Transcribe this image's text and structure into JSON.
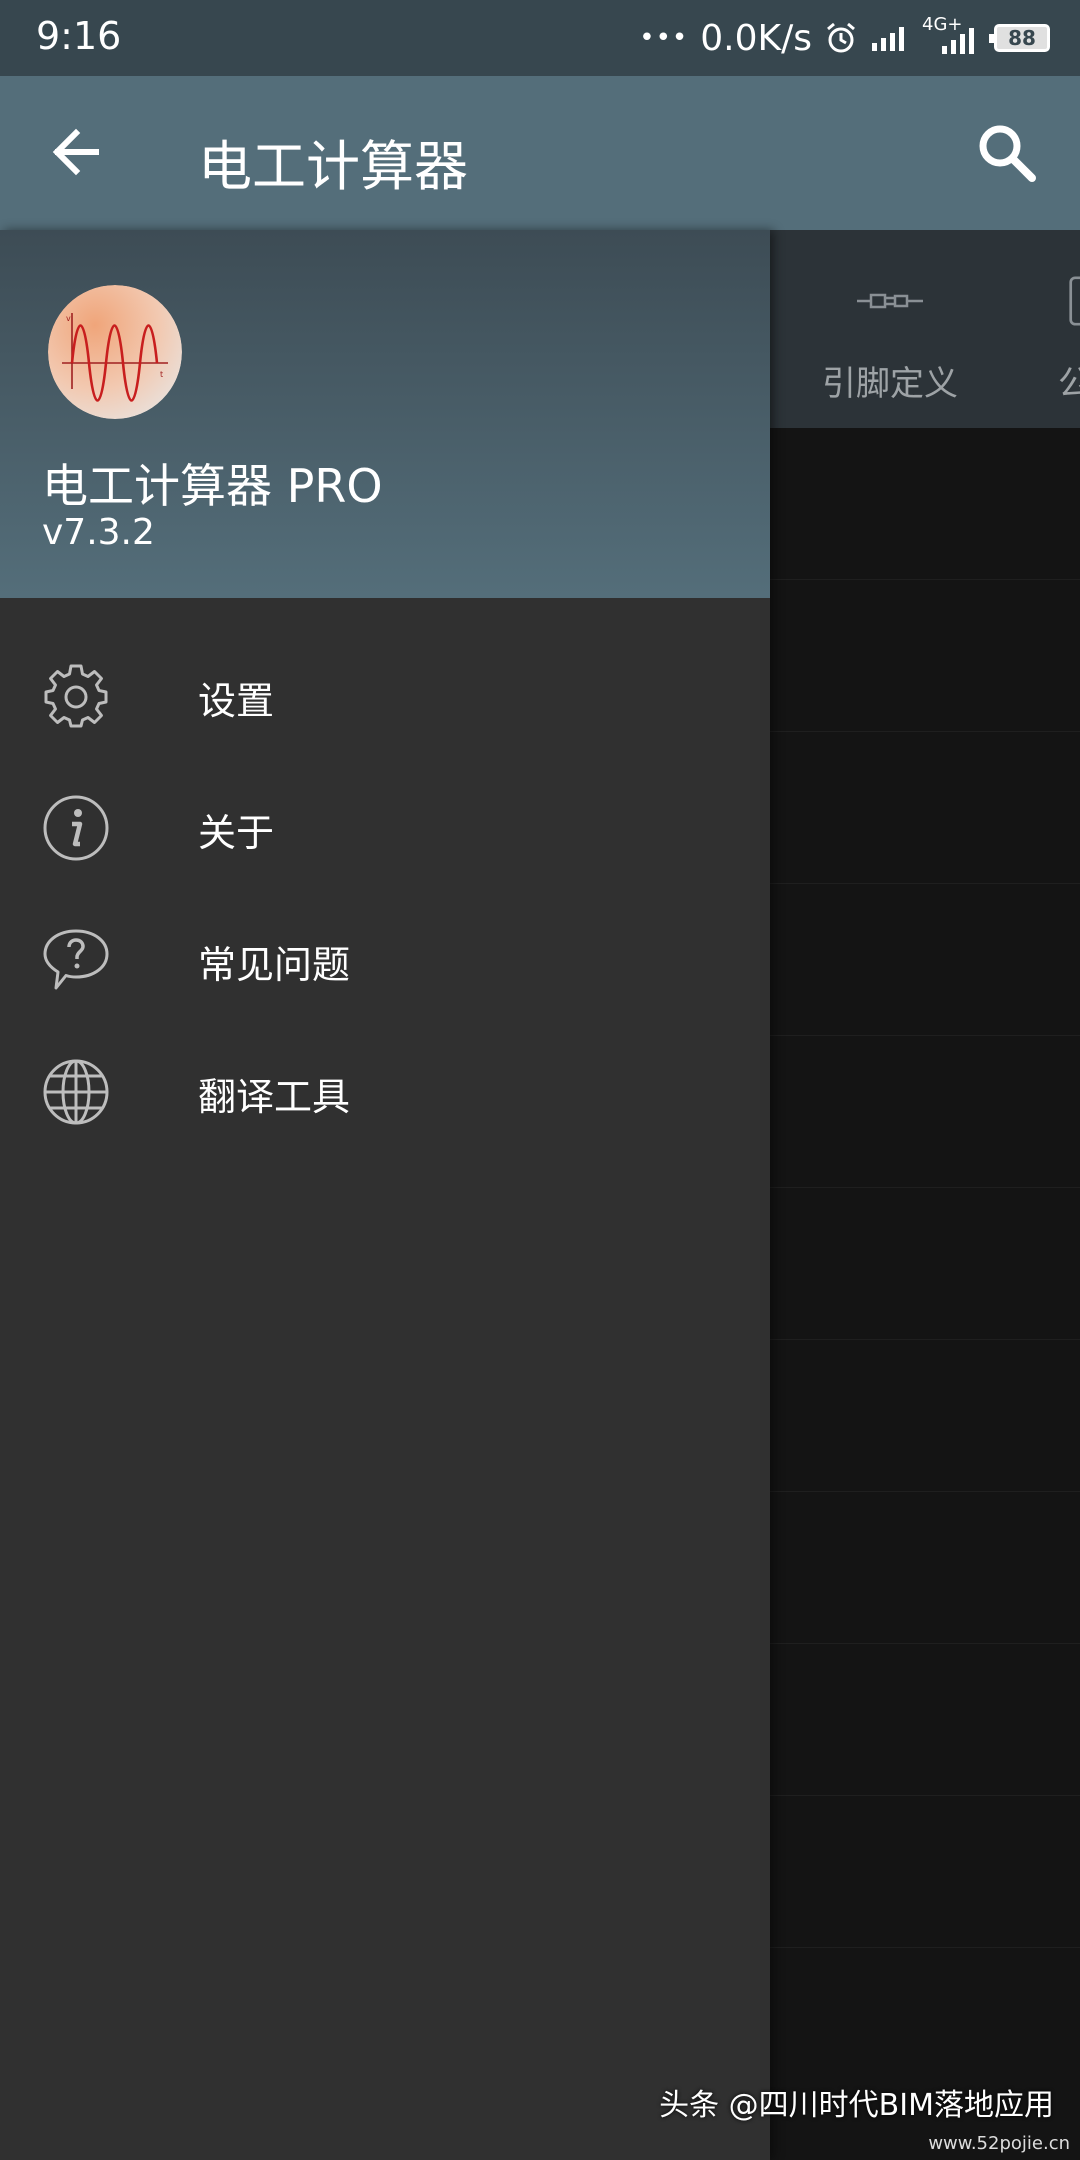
{
  "status_bar": {
    "time": "9:16",
    "dots": "•••",
    "net_speed": "0.0K/s",
    "alarm_icon": "alarm-icon",
    "network_label": "4G+",
    "battery": "88"
  },
  "toolbar": {
    "back_icon": "arrow-back-icon",
    "title": "电工计算器",
    "search_icon": "search-icon"
  },
  "background_tabs": [
    {
      "label": "引脚定义",
      "icon": "connector-icon"
    },
    {
      "label": "公",
      "icon": "device-icon"
    }
  ],
  "drawer": {
    "app_name": "电工计算器 PRO",
    "version": "v7.3.2",
    "menu": [
      {
        "label": "设置",
        "icon": "gear-icon"
      },
      {
        "label": "关于",
        "icon": "info-icon"
      },
      {
        "label": "常见问题",
        "icon": "faq-icon"
      },
      {
        "label": "翻译工具",
        "icon": "globe-icon"
      }
    ]
  },
  "watermark": {
    "text": "头条 @四川时代BIM落地应用",
    "url": "www.52pojie.cn"
  }
}
